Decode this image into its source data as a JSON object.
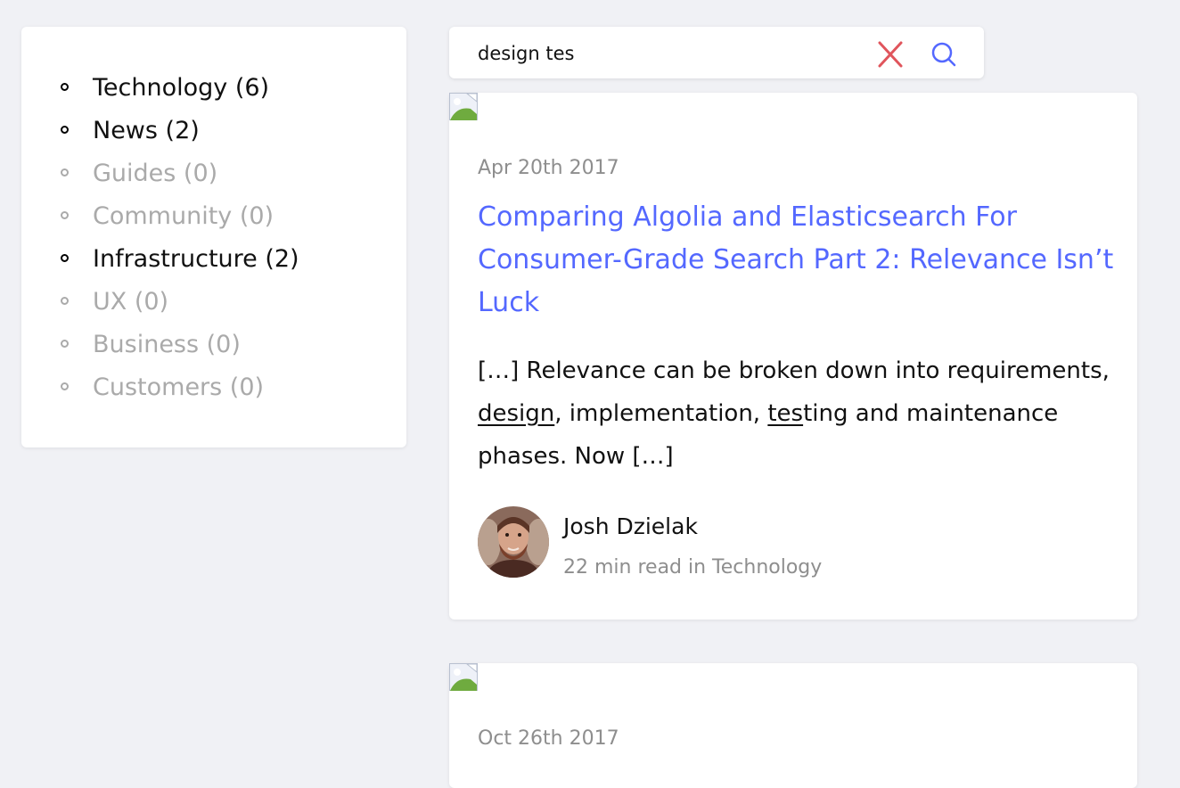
{
  "sidebar": {
    "categories": [
      {
        "label": "Technology (6)",
        "enabled": true
      },
      {
        "label": "News (2)",
        "enabled": true
      },
      {
        "label": "Guides (0)",
        "enabled": false
      },
      {
        "label": "Community (0)",
        "enabled": false
      },
      {
        "label": "Infrastructure (2)",
        "enabled": true
      },
      {
        "label": "UX (0)",
        "enabled": false
      },
      {
        "label": "Business (0)",
        "enabled": false
      },
      {
        "label": "Customers (0)",
        "enabled": false
      }
    ]
  },
  "search": {
    "value": "design tes",
    "clear_icon": "close-icon",
    "search_icon": "search-icon"
  },
  "colors": {
    "accent": "#5468ff",
    "clear": "#e0555c",
    "muted": "#aaaaaa",
    "background": "#f0f1f5"
  },
  "results": [
    {
      "date": "Apr 20th 2017",
      "title": "Comparing Algolia and Elasticsearch For Consumer-Grade Search Part 2: Relevance Isn’t Luck",
      "excerpt": {
        "prefix": "[…] Relevance can be broken down into requirements, ",
        "highlight1": "design",
        "middle": ", implementation, ",
        "highlight2": "tes",
        "suffix": "ting and maintenance phases. Now […]"
      },
      "author": "Josh Dzielak",
      "meta": "22 min read in Technology"
    },
    {
      "date": "Oct 26th 2017"
    }
  ]
}
